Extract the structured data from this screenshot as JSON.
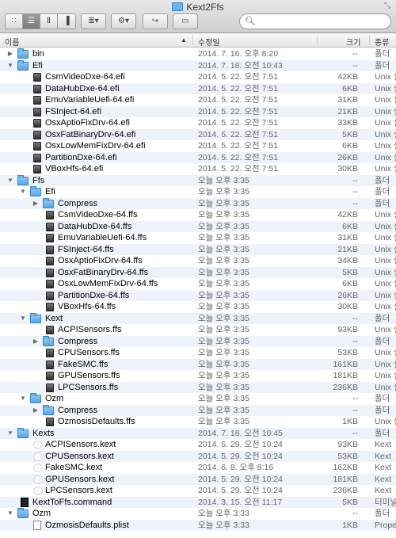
{
  "window": {
    "title": "Kext2Ffs"
  },
  "toolbar": {
    "view_icon": "☰",
    "action_icon": "⚙",
    "arrange_icon": "≣",
    "share_icon": "↪",
    "search_placeholder": ""
  },
  "columns": {
    "name": "이름",
    "date": "수정일",
    "size": "크기",
    "kind": "종류"
  },
  "rows": [
    {
      "depth": 0,
      "disc": "right",
      "icon": "folder",
      "name": "bin",
      "date": "2014. 7. 16. 오후 8:20",
      "size": "--",
      "kind": "폴더"
    },
    {
      "depth": 0,
      "disc": "down",
      "icon": "folder",
      "name": "Efi",
      "date": "2014. 7. 18. 오전 10:43",
      "size": "--",
      "kind": "폴더"
    },
    {
      "depth": 1,
      "disc": "",
      "icon": "efi",
      "name": "CsmVideoDxe-64.efi",
      "date": "2014. 5. 22. 오전 7:51",
      "size": "42KB",
      "kind": "Unix 실"
    },
    {
      "depth": 1,
      "disc": "",
      "icon": "efi",
      "name": "DataHubDxe-64.efi",
      "date": "2014. 5. 22. 오전 7:51",
      "size": "6KB",
      "kind": "Unix 실"
    },
    {
      "depth": 1,
      "disc": "",
      "icon": "efi",
      "name": "EmuVariableUefi-64.efi",
      "date": "2014. 5. 22. 오전 7:51",
      "size": "31KB",
      "kind": "Unix 실"
    },
    {
      "depth": 1,
      "disc": "",
      "icon": "efi",
      "name": "FSInject-64.efi",
      "date": "2014. 5. 22. 오전 7:51",
      "size": "21KB",
      "kind": "Unix 실"
    },
    {
      "depth": 1,
      "disc": "",
      "icon": "efi",
      "name": "OsxAptioFixDrv-64.efi",
      "date": "2014. 5. 22. 오전 7:51",
      "size": "33KB",
      "kind": "Unix 실"
    },
    {
      "depth": 1,
      "disc": "",
      "icon": "efi",
      "name": "OsxFatBinaryDrv-64.efi",
      "date": "2014. 5. 22. 오전 7:51",
      "size": "5KB",
      "kind": "Unix 실"
    },
    {
      "depth": 1,
      "disc": "",
      "icon": "efi",
      "name": "OsxLowMemFixDrv-64.efi",
      "date": "2014. 5. 22. 오전 7:51",
      "size": "6KB",
      "kind": "Unix 실"
    },
    {
      "depth": 1,
      "disc": "",
      "icon": "efi",
      "name": "PartitionDxe-64.efi",
      "date": "2014. 5. 22. 오전 7:51",
      "size": "26KB",
      "kind": "Unix 실"
    },
    {
      "depth": 1,
      "disc": "",
      "icon": "efi",
      "name": "VBoxHfs-64.efi",
      "date": "2014. 5. 22. 오전 7:51",
      "size": "30KB",
      "kind": "Unix 실"
    },
    {
      "depth": 0,
      "disc": "down",
      "icon": "folder",
      "name": "Ffs",
      "date": "오늘 오후 3:35",
      "size": "--",
      "kind": "폴더"
    },
    {
      "depth": 1,
      "disc": "down",
      "icon": "folder",
      "name": "Efi",
      "date": "오늘 오후 3:35",
      "size": "--",
      "kind": "폴더"
    },
    {
      "depth": 2,
      "disc": "right",
      "icon": "folder",
      "name": "Compress",
      "date": "오늘 오후 3:35",
      "size": "--",
      "kind": "폴더"
    },
    {
      "depth": 2,
      "disc": "",
      "icon": "efi",
      "name": "CsmVideoDxe-64.ffs",
      "date": "오늘 오후 3:35",
      "size": "42KB",
      "kind": "Unix 실"
    },
    {
      "depth": 2,
      "disc": "",
      "icon": "efi",
      "name": "DataHubDxe-64.ffs",
      "date": "오늘 오후 3:35",
      "size": "6KB",
      "kind": "Unix 실"
    },
    {
      "depth": 2,
      "disc": "",
      "icon": "efi",
      "name": "EmuVariableUefi-64.ffs",
      "date": "오늘 오후 3:35",
      "size": "31KB",
      "kind": "Unix 실"
    },
    {
      "depth": 2,
      "disc": "",
      "icon": "efi",
      "name": "FSInject-64.ffs",
      "date": "오늘 오후 3:35",
      "size": "21KB",
      "kind": "Unix 실"
    },
    {
      "depth": 2,
      "disc": "",
      "icon": "efi",
      "name": "OsxAptioFixDrv-64.ffs",
      "date": "오늘 오후 3:35",
      "size": "34KB",
      "kind": "Unix 실"
    },
    {
      "depth": 2,
      "disc": "",
      "icon": "efi",
      "name": "OsxFatBinaryDrv-64.ffs",
      "date": "오늘 오후 3:35",
      "size": "5KB",
      "kind": "Unix 실"
    },
    {
      "depth": 2,
      "disc": "",
      "icon": "efi",
      "name": "OsxLowMemFixDrv-64.ffs",
      "date": "오늘 오후 3:35",
      "size": "6KB",
      "kind": "Unix 실"
    },
    {
      "depth": 2,
      "disc": "",
      "icon": "efi",
      "name": "PartitionDxe-64.ffs",
      "date": "오늘 오후 3:35",
      "size": "26KB",
      "kind": "Unix 실"
    },
    {
      "depth": 2,
      "disc": "",
      "icon": "efi",
      "name": "VBoxHfs-64.ffs",
      "date": "오늘 오후 3:35",
      "size": "30KB",
      "kind": "Unix 실"
    },
    {
      "depth": 1,
      "disc": "down",
      "icon": "folder",
      "name": "Kext",
      "date": "오늘 오후 3:35",
      "size": "--",
      "kind": "폴더"
    },
    {
      "depth": 2,
      "disc": "",
      "icon": "efi",
      "name": "ACPISensors.ffs",
      "date": "오늘 오후 3:35",
      "size": "93KB",
      "kind": "Unix 실"
    },
    {
      "depth": 2,
      "disc": "right",
      "icon": "folder",
      "name": "Compress",
      "date": "오늘 오후 3:35",
      "size": "--",
      "kind": "폴더"
    },
    {
      "depth": 2,
      "disc": "",
      "icon": "efi",
      "name": "CPUSensors.ffs",
      "date": "오늘 오후 3:35",
      "size": "53KB",
      "kind": "Unix 실"
    },
    {
      "depth": 2,
      "disc": "",
      "icon": "efi",
      "name": "FakeSMC.ffs",
      "date": "오늘 오후 3:35",
      "size": "161KB",
      "kind": "Unix 실"
    },
    {
      "depth": 2,
      "disc": "",
      "icon": "efi",
      "name": "GPUSensors.ffs",
      "date": "오늘 오후 3:35",
      "size": "181KB",
      "kind": "Unix 실"
    },
    {
      "depth": 2,
      "disc": "",
      "icon": "efi",
      "name": "LPCSensors.ffs",
      "date": "오늘 오후 3:35",
      "size": "236KB",
      "kind": "Unix 실"
    },
    {
      "depth": 1,
      "disc": "down",
      "icon": "folder",
      "name": "Ozm",
      "date": "오늘 오후 3:35",
      "size": "--",
      "kind": "폴더"
    },
    {
      "depth": 2,
      "disc": "right",
      "icon": "folder",
      "name": "Compress",
      "date": "오늘 오후 3:35",
      "size": "--",
      "kind": "폴더"
    },
    {
      "depth": 2,
      "disc": "",
      "icon": "efi",
      "name": "OzmosisDefaults.ffs",
      "date": "오늘 오후 3:35",
      "size": "1KB",
      "kind": "Unix 실"
    },
    {
      "depth": 0,
      "disc": "down",
      "icon": "folder",
      "name": "Kexts",
      "date": "2014. 7. 18. 오전 10:45",
      "size": "--",
      "kind": "폴더"
    },
    {
      "depth": 1,
      "disc": "",
      "icon": "kext",
      "name": "ACPISensors.kext",
      "date": "2014. 5. 29. 오전 10:24",
      "size": "93KB",
      "kind": "Kext"
    },
    {
      "depth": 1,
      "disc": "",
      "icon": "kext",
      "name": "CPUSensors.kext",
      "date": "2014. 5. 29. 오전 10:24",
      "size": "53KB",
      "kind": "Kext"
    },
    {
      "depth": 1,
      "disc": "",
      "icon": "kext",
      "name": "FakeSMC.kext",
      "date": "2014. 6. 8. 오후 8:16",
      "size": "162KB",
      "kind": "Kext"
    },
    {
      "depth": 1,
      "disc": "",
      "icon": "kext",
      "name": "GPUSensors.kext",
      "date": "2014. 5. 29. 오전 10:24",
      "size": "181KB",
      "kind": "Kext"
    },
    {
      "depth": 1,
      "disc": "",
      "icon": "kext",
      "name": "LPCSensors.kext",
      "date": "2014. 5. 29. 오전 10:24",
      "size": "236KB",
      "kind": "Kext"
    },
    {
      "depth": 0,
      "disc": "",
      "icon": "cmd",
      "name": "KextToFfs.command",
      "date": "2014. 3. 15. 오전 11:17",
      "size": "5KB",
      "kind": "터미널"
    },
    {
      "depth": 0,
      "disc": "down",
      "icon": "folder",
      "name": "Ozm",
      "date": "오늘 오후 3:33",
      "size": "--",
      "kind": "폴더"
    },
    {
      "depth": 1,
      "disc": "",
      "icon": "plist",
      "name": "OzmosisDefaults.plist",
      "date": "오늘 오후 3:33",
      "size": "1KB",
      "kind": "Prope"
    }
  ]
}
